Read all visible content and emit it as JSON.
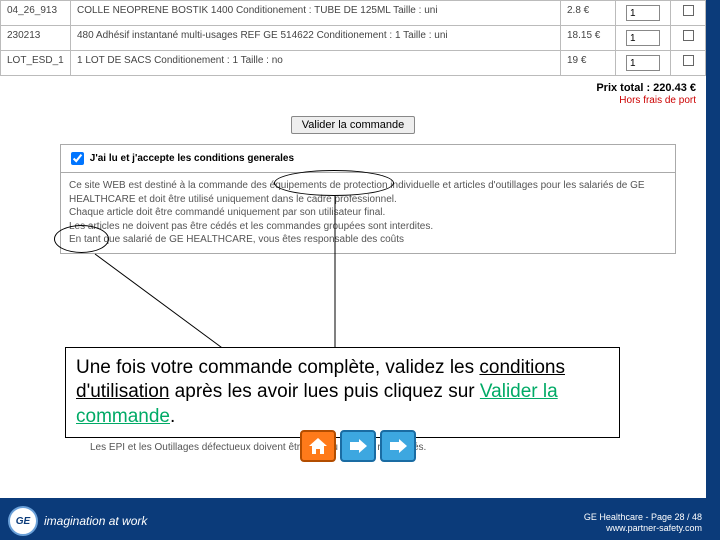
{
  "order": {
    "rows": [
      {
        "ref": "04_26_913",
        "desc": "COLLE NEOPRENE BOSTIK 1400 Conditionement : TUBE DE 125ML Taille : uni",
        "price": "2.8 €",
        "qty": "1"
      },
      {
        "ref": "230213",
        "desc": "480 Adhésif instantané multi-usages REF GE 514622 Conditionement : 1 Taille : uni",
        "price": "18.15 €",
        "qty": "1"
      },
      {
        "ref": "LOT_ESD_1",
        "desc": "1 LOT DE SACS Conditionement : 1 Taille : no",
        "price": "19 €",
        "qty": "1"
      }
    ],
    "total_label": "Prix total : 220.43 €",
    "ship_label": "Hors frais de port",
    "validate_label": "Valider la commande"
  },
  "terms": {
    "checkbox_label": "J'ai lu et j'accepte les conditions generales",
    "line1": "Ce site WEB est destiné à la commande des équipements de protection individuelle et articles d'outillages pour les salariés de GE HEALTHCARE et doit être utilisé uniquement dans le cadre professionnel.",
    "line2": "Chaque article doit être commandé uniquement par son utilisateur final.",
    "line3": "Les articles ne doivent pas être cédés et les commandes groupées sont interdites.",
    "line4": "En tant que salarié de GE HEALTHCARE, vous êtes responsable des coûts",
    "extra": "Les EPI et les Outillages défectueux doivent être mis au rebut et remplacés."
  },
  "callout": {
    "part1": "Une fois votre commande complète, validez les ",
    "underline": "conditions d'utilisation",
    "part2": " après les avoir lues puis cliquez sur ",
    "link": "Valider la commande",
    "part3": "."
  },
  "footer": {
    "tagline": "imagination at work",
    "page": "GE Healthcare - Page 28 / 48",
    "url": "www.partner-safety.com"
  },
  "icons": {
    "home": "home-icon",
    "next": "arrow-right-icon",
    "next2": "arrow-right-icon"
  }
}
